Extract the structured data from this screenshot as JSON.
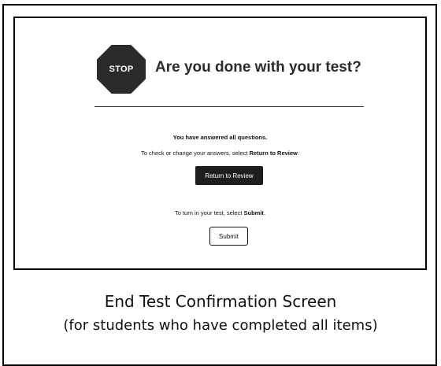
{
  "screen": {
    "stop_sign_text": "STOP",
    "title": "Are you done with your test?",
    "answered_text": "You have answered all questions.",
    "check_text_prefix": "To check or change your answers, select ",
    "check_text_bold": "Return to Review",
    "check_text_suffix": ".",
    "review_button_label": "Return to Review",
    "turn_in_prefix": "To turn in your test, select ",
    "turn_in_bold": "Submit",
    "turn_in_suffix": ".",
    "submit_button_label": "Submit"
  },
  "caption": {
    "title": "End Test Confirmation Screen",
    "subtitle": "(for students who have completed all items)"
  },
  "colors": {
    "stop_sign": "#2b2b2b",
    "primary_button": "#1e1e1e",
    "frame": "#000000"
  }
}
